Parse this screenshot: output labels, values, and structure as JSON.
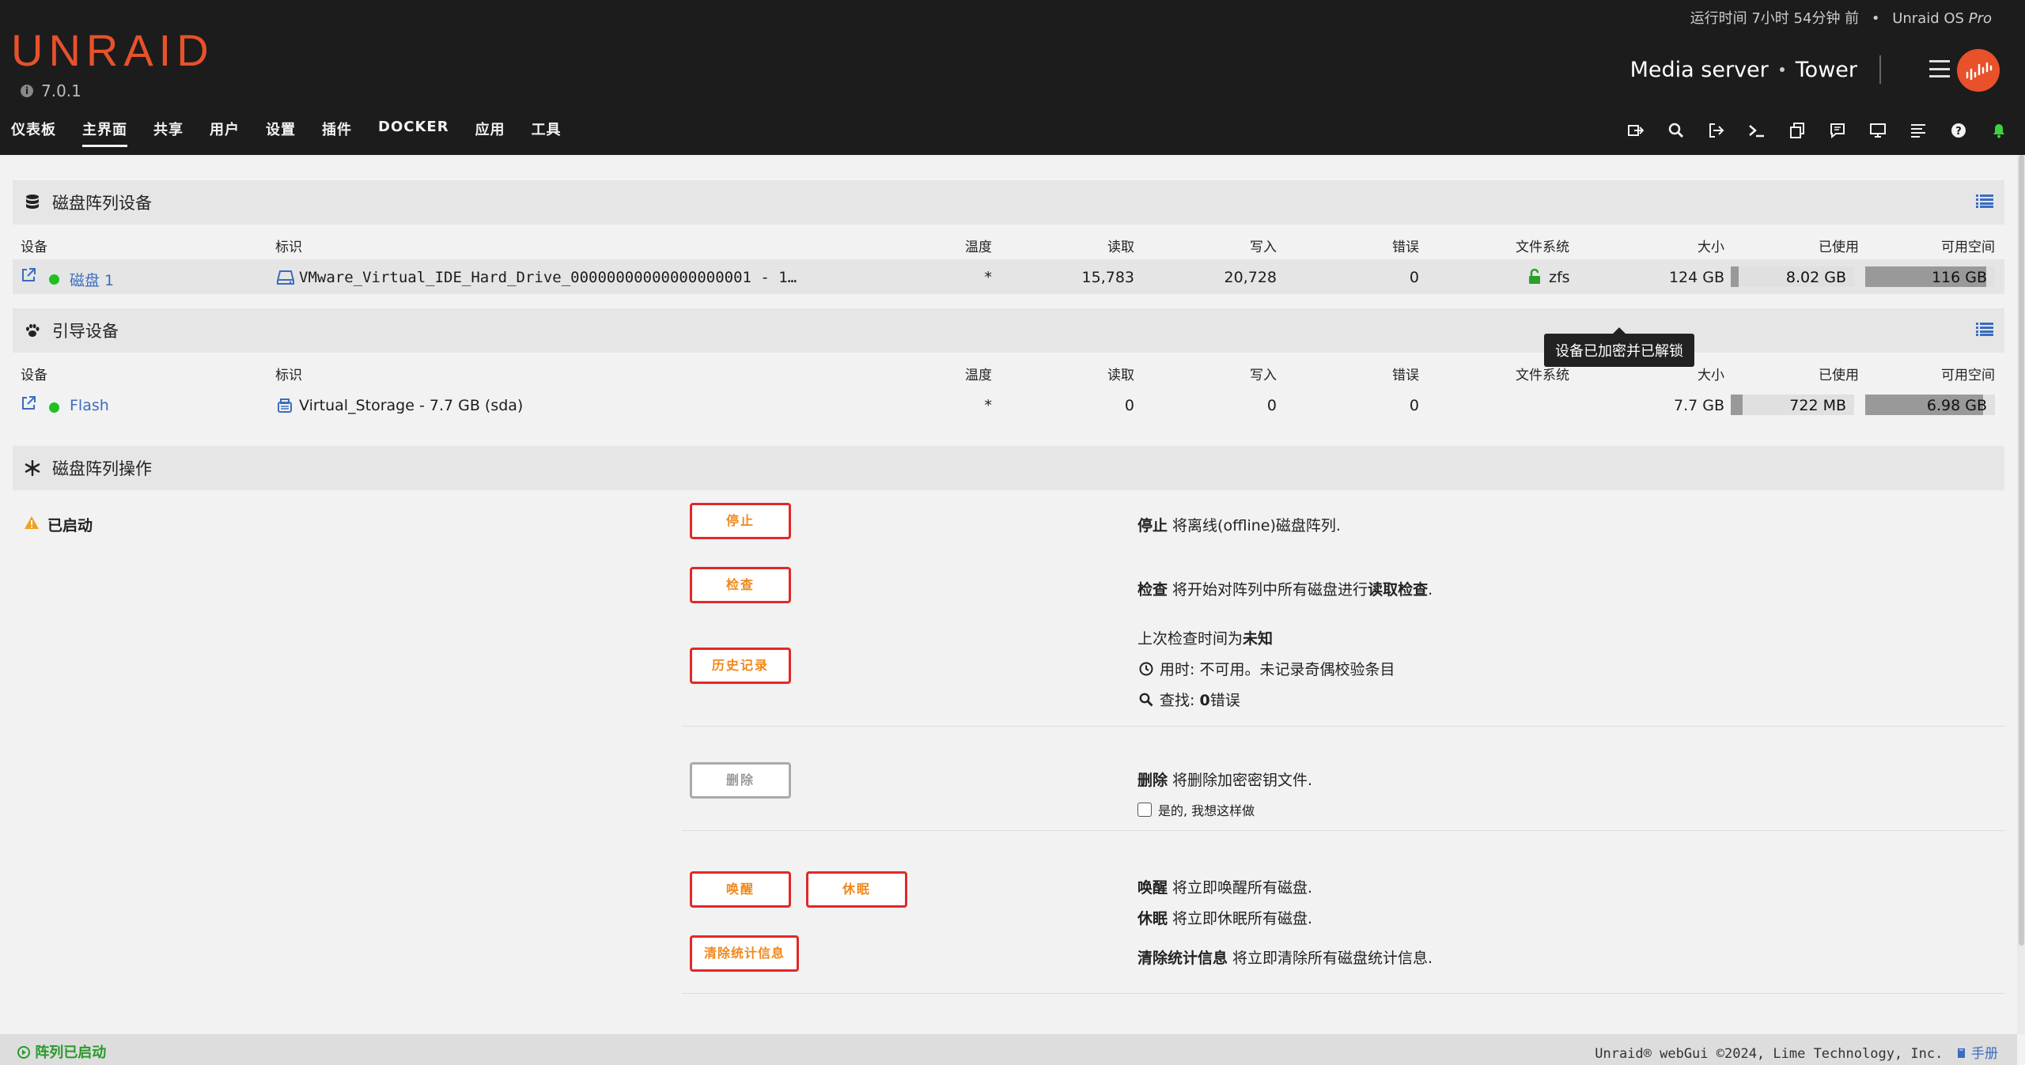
{
  "header": {
    "logo": "UNRAID",
    "version": "7.0.1",
    "uptime_prefix": "运行时间 7小时 54分钟 前",
    "os_name": "Unraid OS",
    "os_edition": "Pro",
    "server_desc": "Media server",
    "server_name": "Tower"
  },
  "nav": {
    "items": [
      "仪表板",
      "主界面",
      "共享",
      "用户",
      "设置",
      "插件",
      "DOCKER",
      "应用",
      "工具"
    ],
    "active": "主界面"
  },
  "toolbar_icons": [
    "terminal-switch-icon",
    "search-icon",
    "logout-icon",
    "terminal-icon",
    "copy-icon",
    "feedback-icon",
    "monitor-icon",
    "log-icon",
    "help-icon",
    "bell-icon"
  ],
  "array": {
    "title": "磁盘阵列设备",
    "headers": [
      "设备",
      "标识",
      "温度",
      "读取",
      "写入",
      "错误",
      "文件系统",
      "大小",
      "已使用",
      "可用空间"
    ],
    "rows": [
      {
        "device": "磁盘 1",
        "identification": "VMware_Virtual_IDE_Hard_Drive_00000000000000000001 - 1…",
        "temp": "*",
        "reads": "15,783",
        "writes": "20,728",
        "errors": "0",
        "fs": "zfs",
        "size": "124 GB",
        "used": "8.02 GB",
        "free": "116 GB",
        "used_fraction": 0.065,
        "free_fraction": 0.935
      }
    ],
    "tooltip": "设备已加密并已解锁"
  },
  "boot": {
    "title": "引导设备",
    "headers": [
      "设备",
      "标识",
      "温度",
      "读取",
      "写入",
      "错误",
      "文件系统",
      "大小",
      "已使用",
      "可用空间"
    ],
    "rows": [
      {
        "device": "Flash",
        "identification": "Virtual_Storage - 7.7 GB (sda)",
        "temp": "*",
        "reads": "0",
        "writes": "0",
        "errors": "0",
        "fs": "",
        "size": "7.7 GB",
        "used": "722 MB",
        "free": "6.98 GB",
        "used_fraction": 0.094,
        "free_fraction": 0.906
      }
    ]
  },
  "operations": {
    "title": "磁盘阵列操作",
    "status": "已启动",
    "stop_btn": "停止",
    "stop_label": "停止",
    "stop_desc": " 将离线(offline)磁盘阵列.",
    "check_btn": "检查",
    "check_label": "检查",
    "check_desc": " 将开始对阵列中所有磁盘进行",
    "check_desc_bold": "读取检查",
    "check_desc_end": ".",
    "history_btn": "历史记录",
    "last_check": "上次检查时间为",
    "last_check_value": "未知",
    "duration": "用时: 不可用。未记录奇偶校验条目",
    "found_label": "查找: ",
    "found_value": "0",
    "found_suffix": "错误",
    "delete_btn": "删除",
    "delete_label": "删除",
    "delete_desc": " 将删除加密密钥文件.",
    "delete_confirm": "是的, 我想这样做",
    "spinup_btn": "唤醒",
    "spindown_btn": "休眠",
    "spinup_label": "唤醒",
    "spinup_desc": " 将立即唤醒所有磁盘.",
    "spindown_label": "休眠",
    "spindown_desc": " 将立即休眠所有磁盘.",
    "clear_btn": "清除统计信息",
    "clear_label": "清除统计信息",
    "clear_desc": " 将立即清除所有磁盘统计信息."
  },
  "footer": {
    "status": "阵列已启动",
    "copyright": "Unraid® webGui ©2024, Lime Technology, Inc.",
    "manual": "手册"
  },
  "colors": {
    "accent": "#e8512a",
    "header_bg": "#1c1c1c",
    "link": "#3c6cbf",
    "btn_border": "#e22828",
    "btn_text": "#f0881a",
    "online": "#20c020"
  }
}
